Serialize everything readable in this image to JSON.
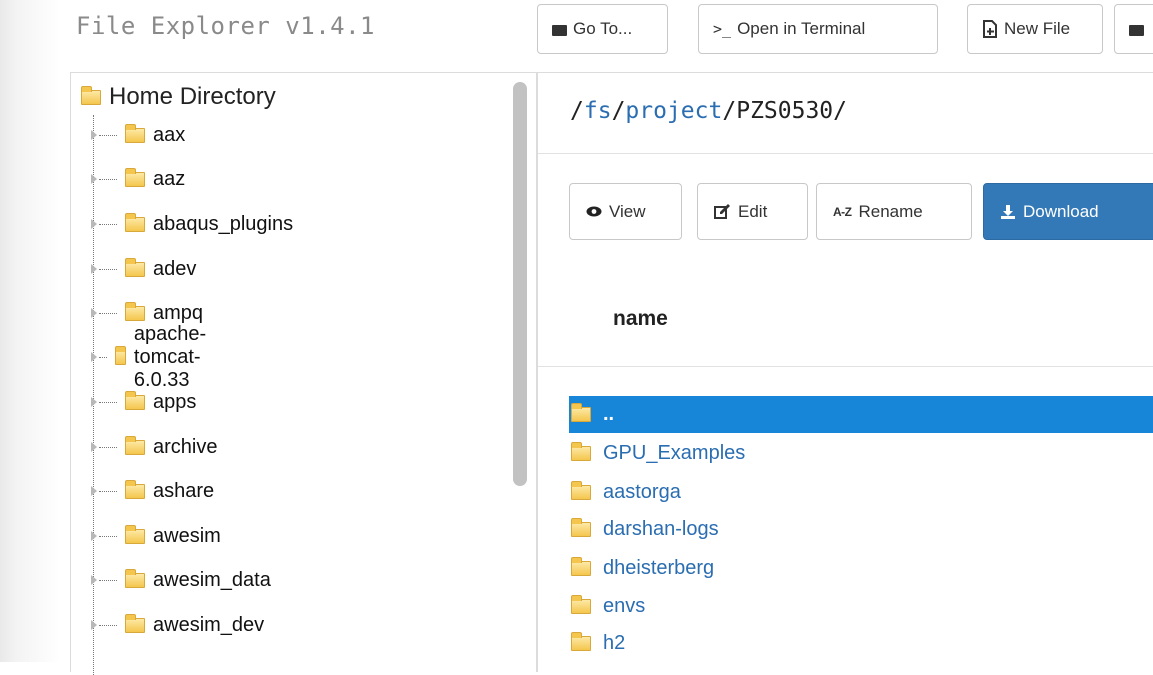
{
  "app": {
    "title": "File Explorer v1.4.1"
  },
  "toolbar": {
    "goto_label": "Go To...",
    "terminal_label": "Open in Terminal",
    "newfile_label": "New File"
  },
  "tree": {
    "root_label": "Home Directory",
    "items": [
      "aax",
      "aaz",
      "abaqus_plugins",
      "adev",
      "ampq",
      "apache-tomcat-6.0.33",
      "apps",
      "archive",
      "ashare",
      "awesim",
      "awesim_data",
      "awesim_dev"
    ]
  },
  "path": {
    "prefix": "/",
    "seg1": "fs",
    "sep1": "/",
    "seg2": "project",
    "sep2": "/",
    "seg3": "PZS0530",
    "sep3": "/"
  },
  "actions": {
    "view_label": "View",
    "edit_label": "Edit",
    "rename_label": "Rename",
    "download_label": "Download"
  },
  "table": {
    "column_name": "name",
    "rows": [
      "..",
      "GPU_Examples",
      "aastorga",
      "darshan-logs",
      "dheisterberg",
      "envs",
      "h2"
    ],
    "selected_index": 0
  },
  "colors": {
    "accent": "#1785d8",
    "primary_button": "#3479b7",
    "link": "#2a6db1",
    "folder": "#f4c64d"
  },
  "icons": {
    "goto": "folder-icon",
    "terminal": "terminal-icon",
    "newfile": "new-file-icon",
    "view": "eye-icon",
    "edit": "edit-icon",
    "rename": "az-rename-icon",
    "download": "download-icon"
  }
}
